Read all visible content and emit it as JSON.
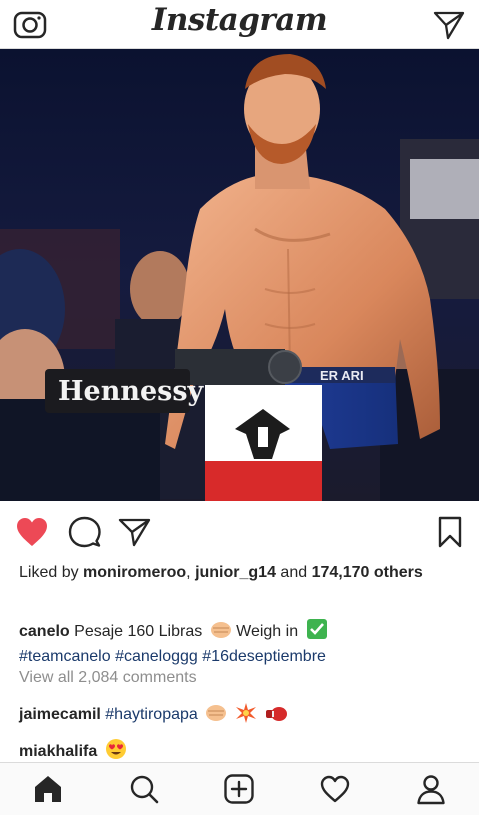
{
  "header": {
    "logo_text": "Instagram"
  },
  "post": {
    "liked_prefix": "Liked by ",
    "liked_user_1": "moniromeroo",
    "liked_sep": ", ",
    "liked_user_2": "junior_g14",
    "liked_and": " and ",
    "liked_count": "174,170",
    "liked_others": " others",
    "caption_user": "canelo",
    "caption_text": "Pesaje 160 Libras",
    "caption_text2": "Weigh in",
    "hashtags": [
      "#teamcanelo",
      "#caneloggg",
      "#16deseptiembre"
    ],
    "view_comments": "View all 2,084 comments",
    "comments": [
      {
        "user": "jaimecamil",
        "text": "#haytiropapa"
      },
      {
        "user": "miakhalifa",
        "text": ""
      }
    ]
  },
  "photo": {
    "sponsor_text": "Hennessy",
    "shorts_text": "ER ARI"
  },
  "colors": {
    "like_red": "#ed4956",
    "hashtag_blue": "#1b3a6b",
    "muted": "#8e8e8e",
    "border": "#dbdbdb"
  }
}
